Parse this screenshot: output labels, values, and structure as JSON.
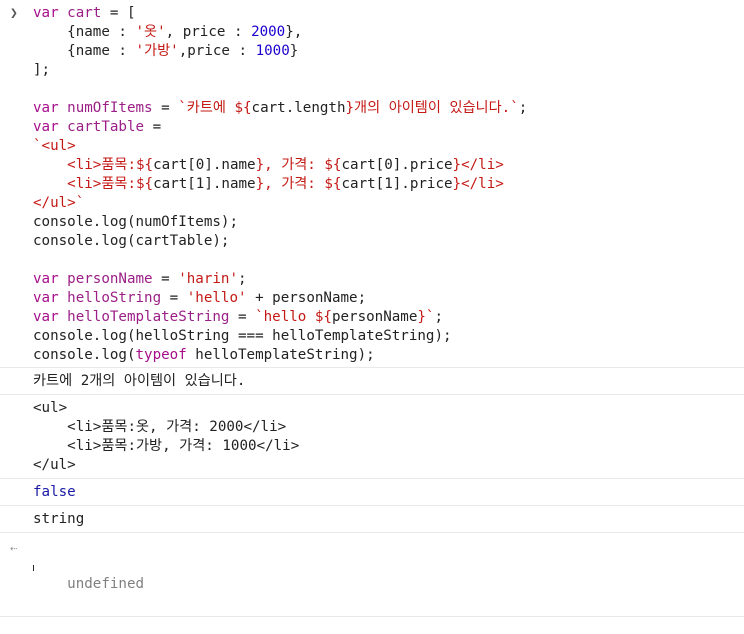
{
  "prompt_icon": "chevron-right-icon",
  "return_icon": "return-arrow-icon",
  "code_lines": [
    [
      [
        "k",
        "var "
      ],
      [
        "v",
        "cart"
      ],
      [
        "p",
        " = ["
      ]
    ],
    [
      [
        "p",
        "    {name : "
      ],
      [
        "s",
        "'옷'"
      ],
      [
        "p",
        ", price : "
      ],
      [
        "n",
        "2000"
      ],
      [
        "p",
        "},"
      ]
    ],
    [
      [
        "p",
        "    {name : "
      ],
      [
        "s",
        "'가방'"
      ],
      [
        "p",
        ",price : "
      ],
      [
        "n",
        "1000"
      ],
      [
        "p",
        "}"
      ]
    ],
    [
      [
        "p",
        "];"
      ]
    ],
    [
      [
        "p",
        ""
      ]
    ],
    [
      [
        "k",
        "var "
      ],
      [
        "v",
        "numOfItems"
      ],
      [
        "p",
        " = "
      ],
      [
        "s",
        "`카트에 ${"
      ],
      [
        "p",
        "cart.length"
      ],
      [
        "s",
        "}개의 아이템이 있습니다.`"
      ],
      [
        "p",
        ";"
      ]
    ],
    [
      [
        "k",
        "var "
      ],
      [
        "v",
        "cartTable"
      ],
      [
        "p",
        " ="
      ]
    ],
    [
      [
        "s",
        "`<ul>"
      ]
    ],
    [
      [
        "s",
        "    <li>품목:${"
      ],
      [
        "p",
        "cart[0].name"
      ],
      [
        "s",
        "}, 가격: ${"
      ],
      [
        "p",
        "cart[0].price"
      ],
      [
        "s",
        "}</li>"
      ]
    ],
    [
      [
        "s",
        "    <li>품목:${"
      ],
      [
        "p",
        "cart[1].name"
      ],
      [
        "s",
        "}, 가격: ${"
      ],
      [
        "p",
        "cart[1].price"
      ],
      [
        "s",
        "}</li>"
      ]
    ],
    [
      [
        "s",
        "</ul>`"
      ]
    ],
    [
      [
        "p",
        "console.log(numOfItems);"
      ]
    ],
    [
      [
        "p",
        "console.log(cartTable);"
      ]
    ],
    [
      [
        "p",
        ""
      ]
    ],
    [
      [
        "k",
        "var "
      ],
      [
        "v",
        "personName"
      ],
      [
        "p",
        " = "
      ],
      [
        "s",
        "'harin'"
      ],
      [
        "p",
        ";"
      ]
    ],
    [
      [
        "k",
        "var "
      ],
      [
        "v",
        "helloString"
      ],
      [
        "p",
        " = "
      ],
      [
        "s",
        "'hello'"
      ],
      [
        "p",
        " + personName;"
      ]
    ],
    [
      [
        "k",
        "var "
      ],
      [
        "v",
        "helloTemplateString"
      ],
      [
        "p",
        " = "
      ],
      [
        "s",
        "`hello ${"
      ],
      [
        "p",
        "personName"
      ],
      [
        "s",
        "}`"
      ],
      [
        "p",
        ";"
      ]
    ],
    [
      [
        "p",
        "console.log(helloString === helloTemplateString);"
      ]
    ],
    [
      [
        "p",
        "console.log("
      ],
      [
        "k",
        "typeof"
      ],
      [
        "p",
        " helloTemplateString);"
      ]
    ]
  ],
  "outputs": [
    {
      "text": "카트에 2개의 아이템이 있습니다.",
      "kind": "plain"
    },
    {
      "text": "<ul>\n    <li>품목:옷, 가격: 2000</li>\n    <li>품목:가방, 가격: 1000</li>\n</ul>",
      "kind": "plain"
    },
    {
      "text": "false",
      "kind": "bool"
    },
    {
      "text": "string",
      "kind": "plain"
    }
  ],
  "return_value": "undefined"
}
